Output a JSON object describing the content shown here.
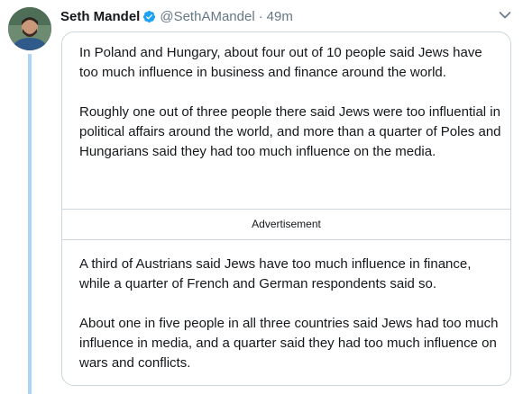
{
  "author": {
    "name": "Seth Mandel",
    "handle": "@SethAMandel",
    "separator": "·",
    "time": "49m"
  },
  "icons": {
    "verified": "verified-badge-icon",
    "menu": "chevron-down-icon"
  },
  "colors": {
    "verified": "#1da1f2",
    "thread_line": "#acd6f5",
    "muted": "#657786",
    "border": "#ccd6dd"
  },
  "card": {
    "paragraphs_before_ad": [
      "In Poland and Hungary, about four out of 10 people said Jews have too much influence in business and finance around the world.",
      "Roughly one out of three people there said Jews were too influential in political affairs around the world, and more than a quarter of Poles and Hungarians said they had too much influence on the media."
    ],
    "ad_label": "Advertisement",
    "paragraphs_after_ad": [
      "A third of Austrians said Jews have too much influence in finance, while a quarter of French and German respondents said so.",
      "About one in five people in all three countries said Jews had too much influence in media, and a quarter said they had too much influence on wars and conflicts."
    ]
  }
}
